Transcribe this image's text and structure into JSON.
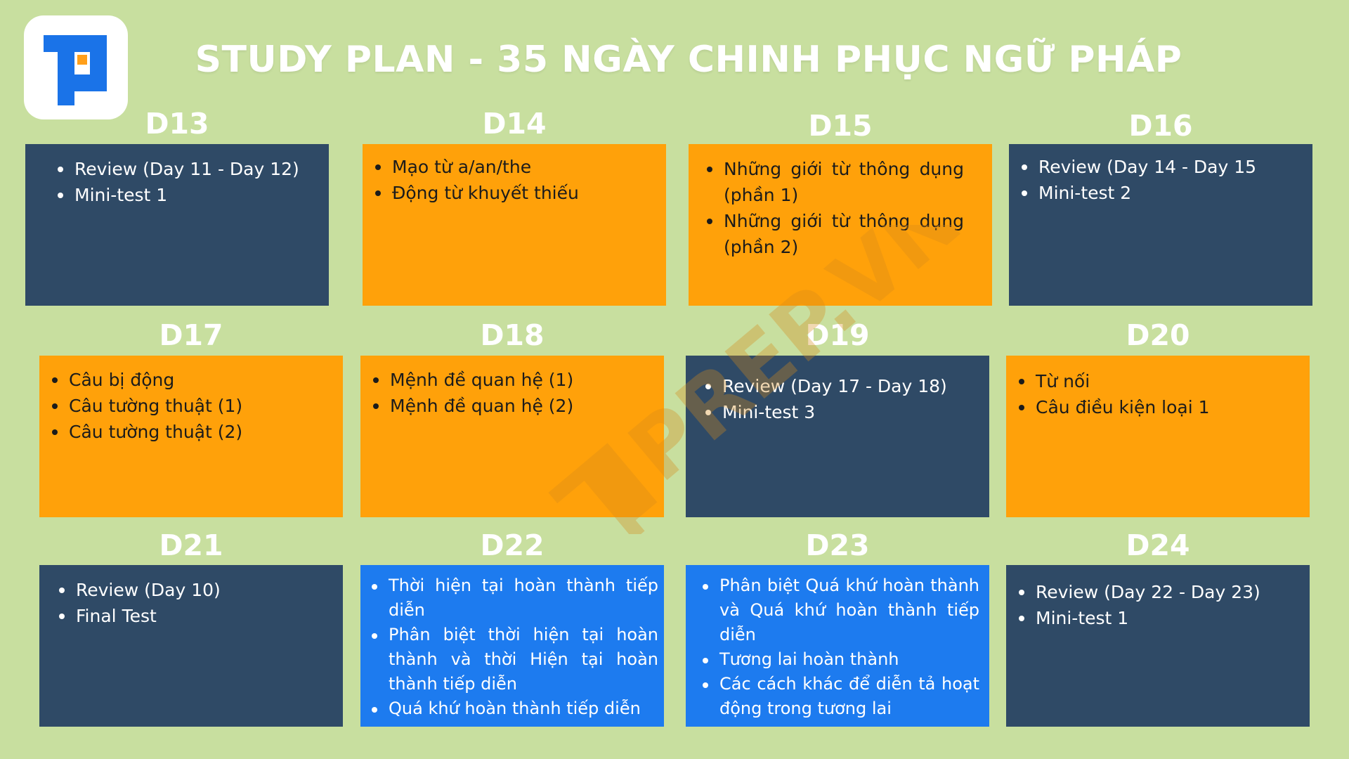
{
  "title": "STUDY PLAN - 35 NGÀY CHINH PHỤC NGỮ PHÁP",
  "watermark_text": "PREP.VN",
  "colors": {
    "background": "#c8df9f",
    "navy": "#2f4a66",
    "orange": "#ffa10a",
    "blue": "#1d7bef",
    "logo_blue": "#1a73e8",
    "logo_orange": "#ff9f1a"
  },
  "days": [
    {
      "label": "D13",
      "items": [
        "Review (Day 11 - Day 12)",
        "Mini-test 1"
      ]
    },
    {
      "label": "D14",
      "items": [
        "Mạo từ a/an/the",
        "Động từ khuyết thiếu"
      ]
    },
    {
      "label": "D15",
      "items": [
        "Những giới từ thông dụng (phần 1)",
        "Những giới từ thông dụng (phần 2)"
      ]
    },
    {
      "label": "D16",
      "items": [
        "Review (Day 14 - Day 15",
        "Mini-test 2"
      ]
    },
    {
      "label": "D17",
      "items": [
        "Câu bị động",
        "Câu tường thuật (1)",
        "Câu tường thuật (2)"
      ]
    },
    {
      "label": "D18",
      "items": [
        "Mệnh đề quan hệ (1)",
        "Mệnh đề quan hệ (2)"
      ]
    },
    {
      "label": "D19",
      "items": [
        "Review (Day 17 - Day 18)",
        "Mini-test 3"
      ]
    },
    {
      "label": "D20",
      "items": [
        "Từ nối",
        "Câu điều kiện loại 1"
      ]
    },
    {
      "label": "D21",
      "items": [
        "Review (Day 10)",
        "Final Test"
      ]
    },
    {
      "label": "D22",
      "items": [
        "Thời hiện tại hoàn thành tiếp diễn",
        "Phân biệt thời hiện tại hoàn thành và thời Hiện tại hoàn thành tiếp diễn",
        "Quá khứ hoàn thành tiếp diễn"
      ]
    },
    {
      "label": "D23",
      "items": [
        "Phân biệt Quá khứ hoàn thành và Quá khứ hoàn thành tiếp diễn",
        "Tương lai hoàn thành",
        "Các cách khác để diễn tả hoạt động trong tương lai"
      ]
    },
    {
      "label": "D24",
      "items": [
        "Review (Day 22 - Day 23)",
        "Mini-test 1"
      ]
    }
  ]
}
